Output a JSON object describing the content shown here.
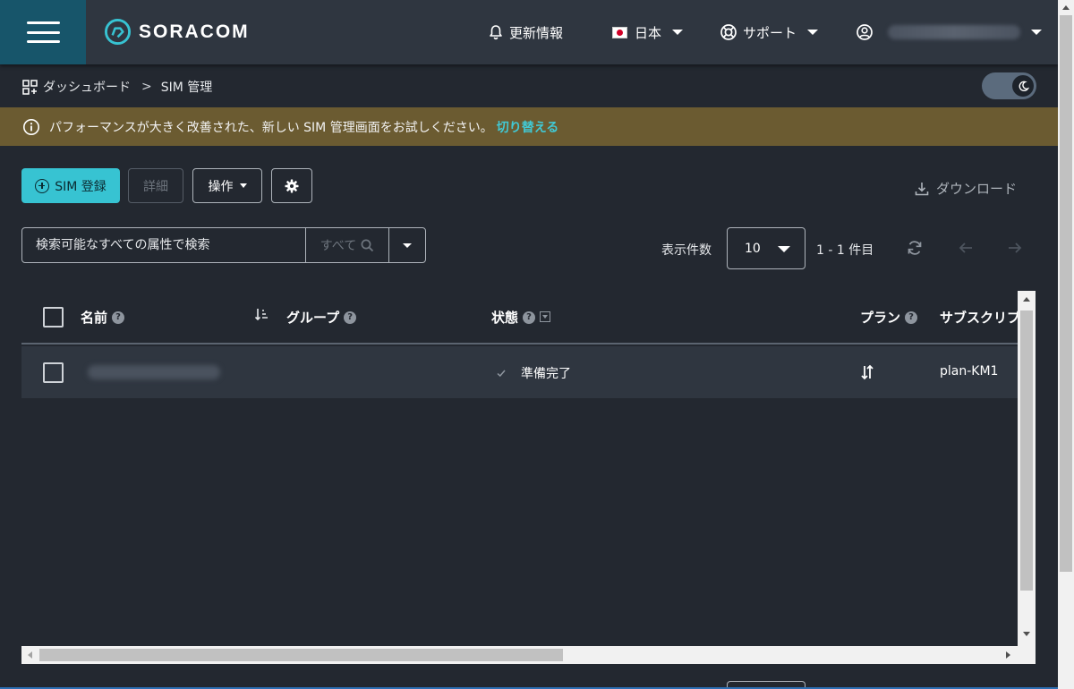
{
  "app": {
    "brand": "SORACOM",
    "colors": {
      "accent": "#37c3d2",
      "topbar": "#2f3640",
      "background": "#232830",
      "banner": "#6b5b31",
      "menu": "#17556a"
    }
  },
  "header": {
    "menu_icon": "hamburger-icon",
    "news_label": "更新情報",
    "language_label": "日本",
    "support_label": "サポート"
  },
  "breadcrumb": {
    "dashboard_label": "ダッシュボード",
    "separator": ">",
    "current_label": "SIM 管理"
  },
  "banner": {
    "message": "パフォーマンスが大きく改善された、新しい SIM 管理画面をお試しください。",
    "link_label": "切り替える"
  },
  "toolbar": {
    "register_label": "SIM 登録",
    "details_label": "詳細",
    "actions_label": "操作",
    "download_label": "ダウンロード"
  },
  "search": {
    "placeholder": "検索可能なすべての属性で検索",
    "scope_label": "すべて"
  },
  "pagination": {
    "per_page_label": "表示件数",
    "per_page_value": "10",
    "range_label": "1 - 1 件目"
  },
  "table": {
    "columns": {
      "name": "名前",
      "group": "グループ",
      "status": "状態",
      "plan": "プラン",
      "subscription": "サブスクリプ"
    },
    "rows": [
      {
        "status": "準備完了",
        "subscription": "plan-KM1"
      }
    ]
  }
}
